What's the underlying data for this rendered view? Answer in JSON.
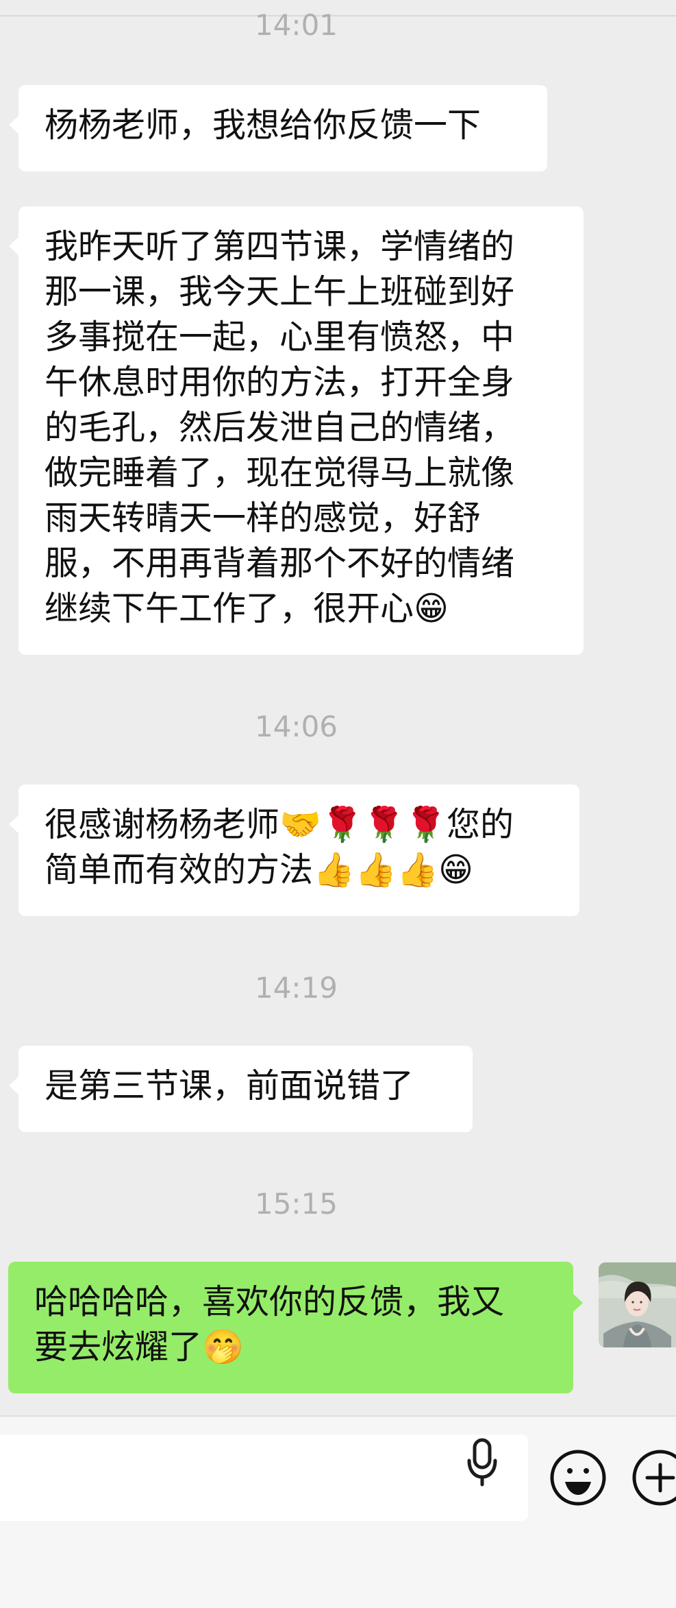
{
  "messages": [
    {
      "type": "time",
      "text": "14:01"
    },
    {
      "type": "in",
      "text": "杨杨老师，我想给你反馈一下"
    },
    {
      "type": "in",
      "text": "我昨天听了第四节课，学情绪的那一课，我今天上午上班碰到好多事搅在一起，心里有愤怒，中午休息时用你的方法，打开全身的毛孔，然后发泄自己的情绪，做完睡着了，现在觉得马上就像雨天转晴天一样的感觉，好舒服，不用再背着那个不好的情绪继续下午工作了，很开心😁"
    },
    {
      "type": "time",
      "text": "14:06"
    },
    {
      "type": "in",
      "text": "很感谢杨杨老师🤝🌹🌹🌹您的简单而有效的方法👍👍👍😁"
    },
    {
      "type": "time",
      "text": "14:19"
    },
    {
      "type": "in",
      "text": "是第三节课，前面说错了"
    },
    {
      "type": "time",
      "text": "15:15"
    },
    {
      "type": "out",
      "text": "哈哈哈哈，喜欢你的反馈，我又要去炫耀了🤭"
    }
  ],
  "chat": {
    "time_0": "14:01",
    "msg_1": "杨杨老师，我想给你反馈一下",
    "msg_2": "我昨天听了第四节课，学情绪的\n那一课，我今天上午上班碰到好\n多事搅在一起，心里有愤怒，中\n午休息时用你的方法，打开全身\n的毛孔，然后发泄自己的情绪，\n做完睡着了，现在觉得马上就像\n雨天转晴天一样的感觉，好舒\n服，不用再背着那个不好的情绪\n继续下午工作了，很开心😁",
    "time_3": "14:06",
    "msg_4": "很感谢杨杨老师🤝🌹🌹🌹您的\n简单而有效的方法👍👍👍😁",
    "time_5": "14:19",
    "msg_6": "是第三节课，前面说错了",
    "time_7": "15:15",
    "msg_8": "哈哈哈哈，喜欢你的反馈，我又\n要去炫耀了🤭"
  },
  "input_bar": {
    "text_value": "",
    "icons": [
      "microphone-icon",
      "emoji-icon",
      "plus-icon"
    ]
  },
  "colors": {
    "background": "#ededed",
    "incoming_bubble": "#ffffff",
    "outgoing_bubble": "#95ec69",
    "timestamp_text": "#b0b0b0",
    "input_bar": "#f6f6f6"
  }
}
